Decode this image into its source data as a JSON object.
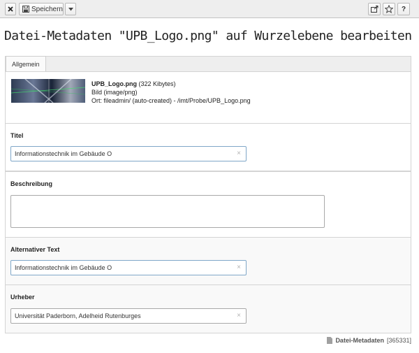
{
  "toolbar": {
    "close_icon": "close-icon",
    "save_label": "Speichern",
    "dropdown_icon": "chevron-down-icon",
    "right_icons": [
      "open-new-window-icon",
      "bookmark-star-icon",
      "help-icon"
    ],
    "help_label": "?"
  },
  "page": {
    "title": "Datei-Metadaten \"UPB_Logo.png\" auf Wurzelebene bearbeiten"
  },
  "tabs": [
    {
      "label": "Allgemein",
      "active": true
    }
  ],
  "file": {
    "name": "UPB_Logo.png",
    "size": "(322 Kibytes)",
    "type": "Bild (image/png)",
    "location": "Ort: fileadmin/ (auto-created) - /imt/Probe/UPB_Logo.png"
  },
  "fields": {
    "title": {
      "label": "Titel",
      "value": "Informationstechnik im Gebäude O"
    },
    "description": {
      "label": "Beschreibung",
      "value": ""
    },
    "alt": {
      "label": "Alternativer Text",
      "value": "Informationstechnik im Gebäude O"
    },
    "creator": {
      "label": "Urheber",
      "value": "Universität Paderborn, Adelheid Rutenburges"
    }
  },
  "footer": {
    "record_type": "Datei-Metadaten",
    "record_id": "[365331]"
  },
  "colors": {
    "input_border_focus": "#7fa7c8",
    "toolbar_bg": "#eeeeee"
  }
}
